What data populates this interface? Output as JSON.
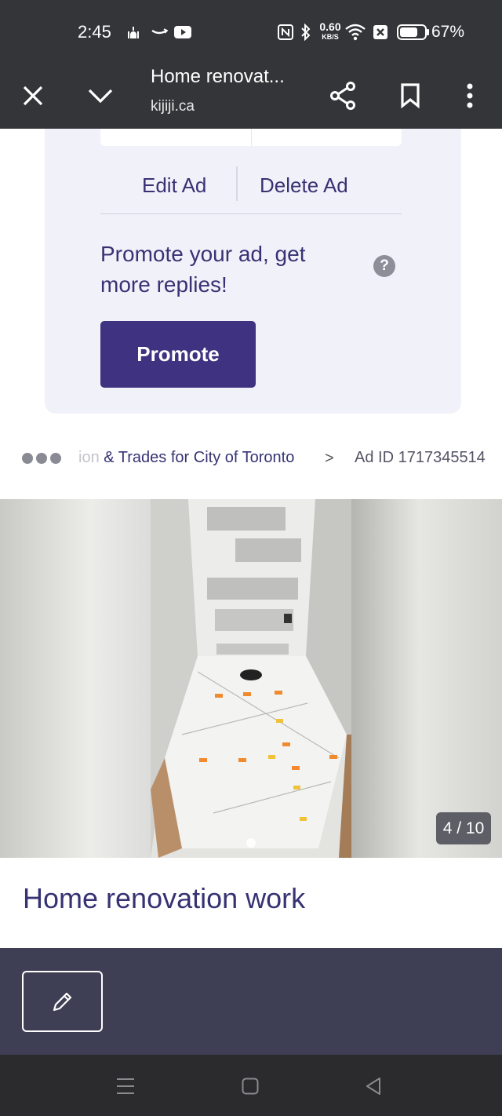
{
  "status_bar": {
    "time": "2:45",
    "net_speed": "0.60",
    "net_unit": "KB/S",
    "battery": "67%",
    "icons": [
      "mosque-icon",
      "amazon-icon",
      "youtube-icon",
      "nfc-icon",
      "bluetooth-icon",
      "wifi-icon",
      "sim-off-icon",
      "battery-icon"
    ]
  },
  "browser": {
    "title": "Home renovat...",
    "url": "kijiji.ca",
    "icons": [
      "close-icon",
      "chevron-down-icon",
      "share-icon",
      "bookmark-icon",
      "more-vert-icon"
    ]
  },
  "ad_card": {
    "edit_label": "Edit Ad",
    "delete_label": "Delete Ad",
    "promo_text": "Promote your ad, get more replies!",
    "help_glyph": "?",
    "promote_label": "Promote"
  },
  "breadcrumb": {
    "faded_part": "ion",
    "link": " & Trades for City of Toronto",
    "chevron": ">",
    "ad_id": "Ad ID 1717345514"
  },
  "gallery": {
    "counter": "4 / 10"
  },
  "ad": {
    "title": "Home renovation work"
  },
  "colors": {
    "system_bar": "#343538",
    "primary": "#3e3281",
    "text": "#373373",
    "card_bg": "#f1f1fa",
    "bottom_bar": "#3e3f54"
  }
}
